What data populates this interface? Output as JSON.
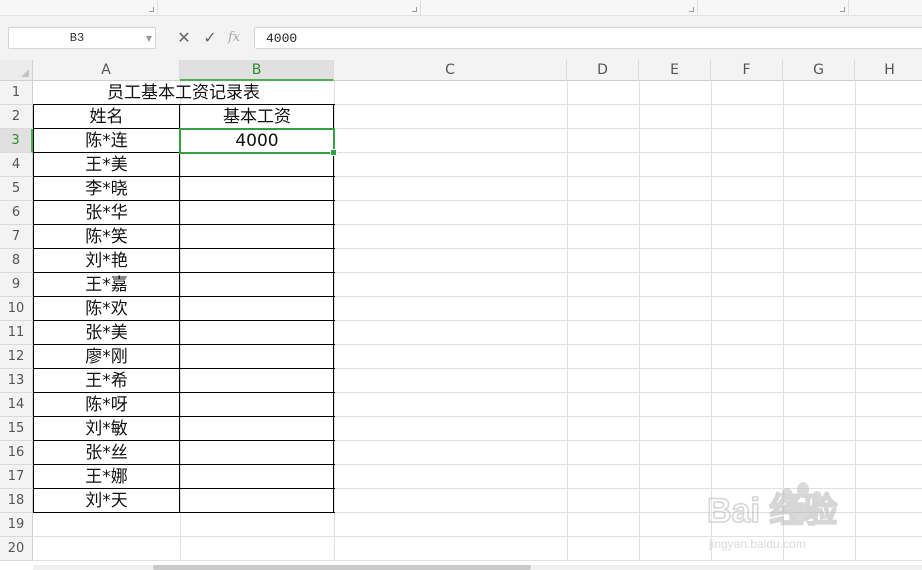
{
  "formula_bar": {
    "name_box": "B3",
    "cancel_icon": "close-icon",
    "confirm_icon": "check-icon",
    "fx_label": "fx",
    "formula_value": "4000"
  },
  "sheet": {
    "columns": [
      "A",
      "B",
      "C",
      "D",
      "E",
      "F",
      "G",
      "H"
    ],
    "rows": [
      "1",
      "2",
      "3",
      "4",
      "5",
      "6",
      "7",
      "8",
      "9",
      "10",
      "11",
      "12",
      "13",
      "14",
      "15",
      "16",
      "17",
      "18",
      "19",
      "20"
    ],
    "selected_column": "B",
    "selected_row": "3",
    "title": "员工基本工资记录表",
    "headers": {
      "name": "姓名",
      "salary": "基本工资"
    },
    "records": [
      {
        "name": "陈*连",
        "salary": "4000"
      },
      {
        "name": "王*美",
        "salary": ""
      },
      {
        "name": "李*晓",
        "salary": ""
      },
      {
        "name": "张*华",
        "salary": ""
      },
      {
        "name": "陈*笑",
        "salary": ""
      },
      {
        "name": "刘*艳",
        "salary": ""
      },
      {
        "name": "王*嘉",
        "salary": ""
      },
      {
        "name": "陈*欢",
        "salary": ""
      },
      {
        "name": "张*美",
        "salary": ""
      },
      {
        "name": "廖*刚",
        "salary": ""
      },
      {
        "name": "王*希",
        "salary": ""
      },
      {
        "name": "陈*呀",
        "salary": ""
      },
      {
        "name": "刘*敏",
        "salary": ""
      },
      {
        "name": "张*丝",
        "salary": ""
      },
      {
        "name": "王*娜",
        "salary": ""
      },
      {
        "name": "刘*天",
        "salary": ""
      }
    ]
  },
  "watermark": {
    "brand": "Bai 经验",
    "url": "jingyan.baidu.com"
  },
  "colors": {
    "selection_green": "#33a047",
    "header_bg": "#f3f3f3",
    "gridline": "#e1e1e1"
  }
}
